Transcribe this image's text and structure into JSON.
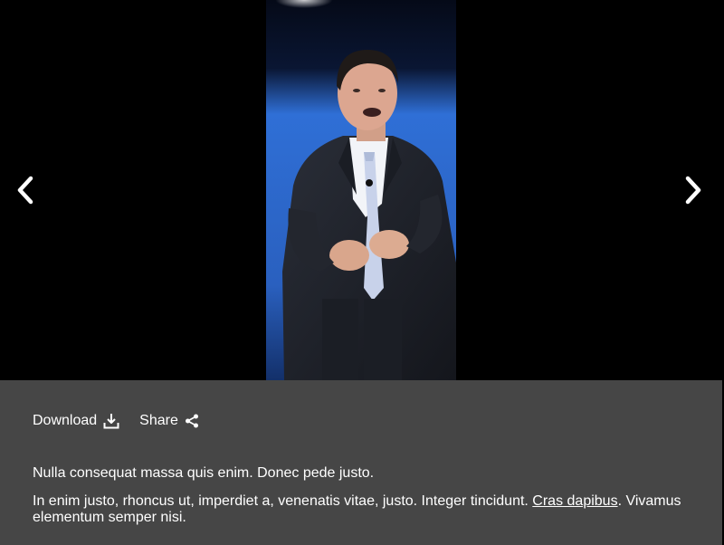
{
  "gallery": {
    "image_alt": "",
    "prev_icon": "chevron-left-icon",
    "next_icon": "chevron-right-icon"
  },
  "actions": {
    "download_label": "Download",
    "download_icon": "download-icon",
    "share_label": "Share",
    "share_icon": "share-icon"
  },
  "caption": {
    "paragraph1": "Nulla consequat massa quis enim. Donec pede justo.",
    "paragraph2_before": "In enim justo, rhoncus ut, imperdiet a, venenatis vitae, justo. Integer tincidunt. ",
    "paragraph2_link": "Cras dapibus",
    "paragraph2_after": ". Vivamus elementum semper nisi."
  },
  "colors": {
    "panel_bg": "#464646",
    "stage_bg": "#000000",
    "text": "#ffffff",
    "backdrop_blue": "#2f6fd6"
  }
}
